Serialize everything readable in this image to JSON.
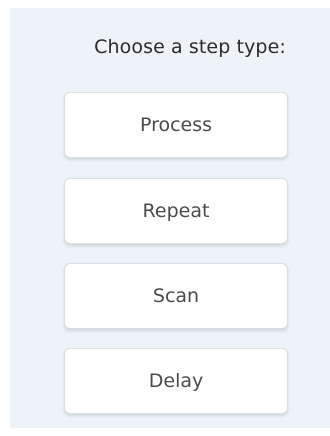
{
  "dialog": {
    "prompt": "Choose a step type:",
    "options": [
      {
        "label": "Process"
      },
      {
        "label": "Repeat"
      },
      {
        "label": "Scan"
      },
      {
        "label": "Delay"
      }
    ]
  },
  "colors": {
    "panel_background": "#eef3f7",
    "button_background": "#ffffff",
    "text": "#2b2b2b"
  }
}
